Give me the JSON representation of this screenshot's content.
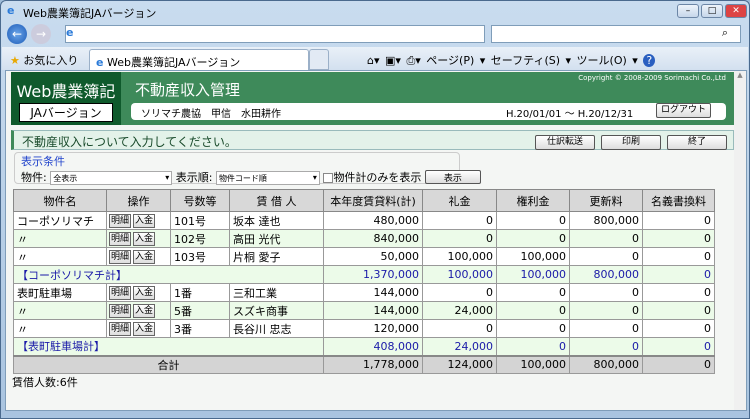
{
  "window": {
    "title": "Web農業簿記JAバージョン"
  },
  "toolbar": {
    "favorites": "お気に入り",
    "tab_title": "Web農業簿記JAバージョン",
    "page": "ページ(P) ▾",
    "safety": "セーフティ(S) ▾",
    "tools": "ツール(O) ▾",
    "help": "?"
  },
  "app": {
    "logo_line1": "Web農業簿記",
    "logo_line2": "JAバージョン",
    "title": "不動産収入管理",
    "copyright": "Copyright © 2008-2009 Sorimachi Co.,Ltd",
    "user_info": "ソリマチ農協　甲信　水田耕作",
    "period": "H.20/01/01 ～ H.20/12/31",
    "logout": "ログアウト"
  },
  "message": {
    "text": "不動産収入について入力してください。",
    "buttons": [
      "仕訳転送",
      "印刷",
      "終了"
    ]
  },
  "conditions": {
    "legend": "表示条件",
    "property_label": "物件:",
    "property_value": "全表示",
    "order_label": "表示順:",
    "order_value": "物件コード順",
    "only_total_label": "物件計のみを表示",
    "show_button": "表示"
  },
  "table": {
    "headers": [
      "物件名",
      "操作",
      "号数等",
      "賃 借 人",
      "本年度賃貸料(計)",
      "礼金",
      "権利金",
      "更新料",
      "名義書換料"
    ],
    "ops": [
      "明細",
      "入金"
    ],
    "rows": [
      {
        "type": "a",
        "name": "コーポソリマチ",
        "no": "101号",
        "tenant": "坂本 達也",
        "vals": [
          "480,000",
          "0",
          "0",
          "800,000",
          "0"
        ]
      },
      {
        "type": "b",
        "name": "〃",
        "no": "102号",
        "tenant": "高田 光代",
        "vals": [
          "840,000",
          "0",
          "0",
          "0",
          "0"
        ]
      },
      {
        "type": "a",
        "name": "〃",
        "no": "103号",
        "tenant": "片桐 愛子",
        "vals": [
          "50,000",
          "100,000",
          "100,000",
          "0",
          "0"
        ]
      },
      {
        "type": "sub",
        "name": "【コーポソリマチ計】",
        "vals": [
          "1,370,000",
          "100,000",
          "100,000",
          "800,000",
          "0"
        ]
      },
      {
        "type": "a",
        "name": "表町駐車場",
        "no": "1番",
        "tenant": "三和工業",
        "vals": [
          "144,000",
          "0",
          "0",
          "0",
          "0"
        ]
      },
      {
        "type": "b",
        "name": "〃",
        "no": "5番",
        "tenant": "スズキ商事",
        "vals": [
          "144,000",
          "24,000",
          "0",
          "0",
          "0"
        ]
      },
      {
        "type": "a",
        "name": "〃",
        "no": "3番",
        "tenant": "長谷川 忠志",
        "vals": [
          "120,000",
          "0",
          "0",
          "0",
          "0"
        ]
      },
      {
        "type": "sub",
        "name": "【表町駐車場計】",
        "vals": [
          "408,000",
          "24,000",
          "0",
          "0",
          "0"
        ]
      }
    ],
    "total": {
      "label": "合計",
      "vals": [
        "1,778,000",
        "124,000",
        "100,000",
        "800,000",
        "0"
      ]
    }
  },
  "footer": {
    "count": "賃借人数:6件"
  }
}
